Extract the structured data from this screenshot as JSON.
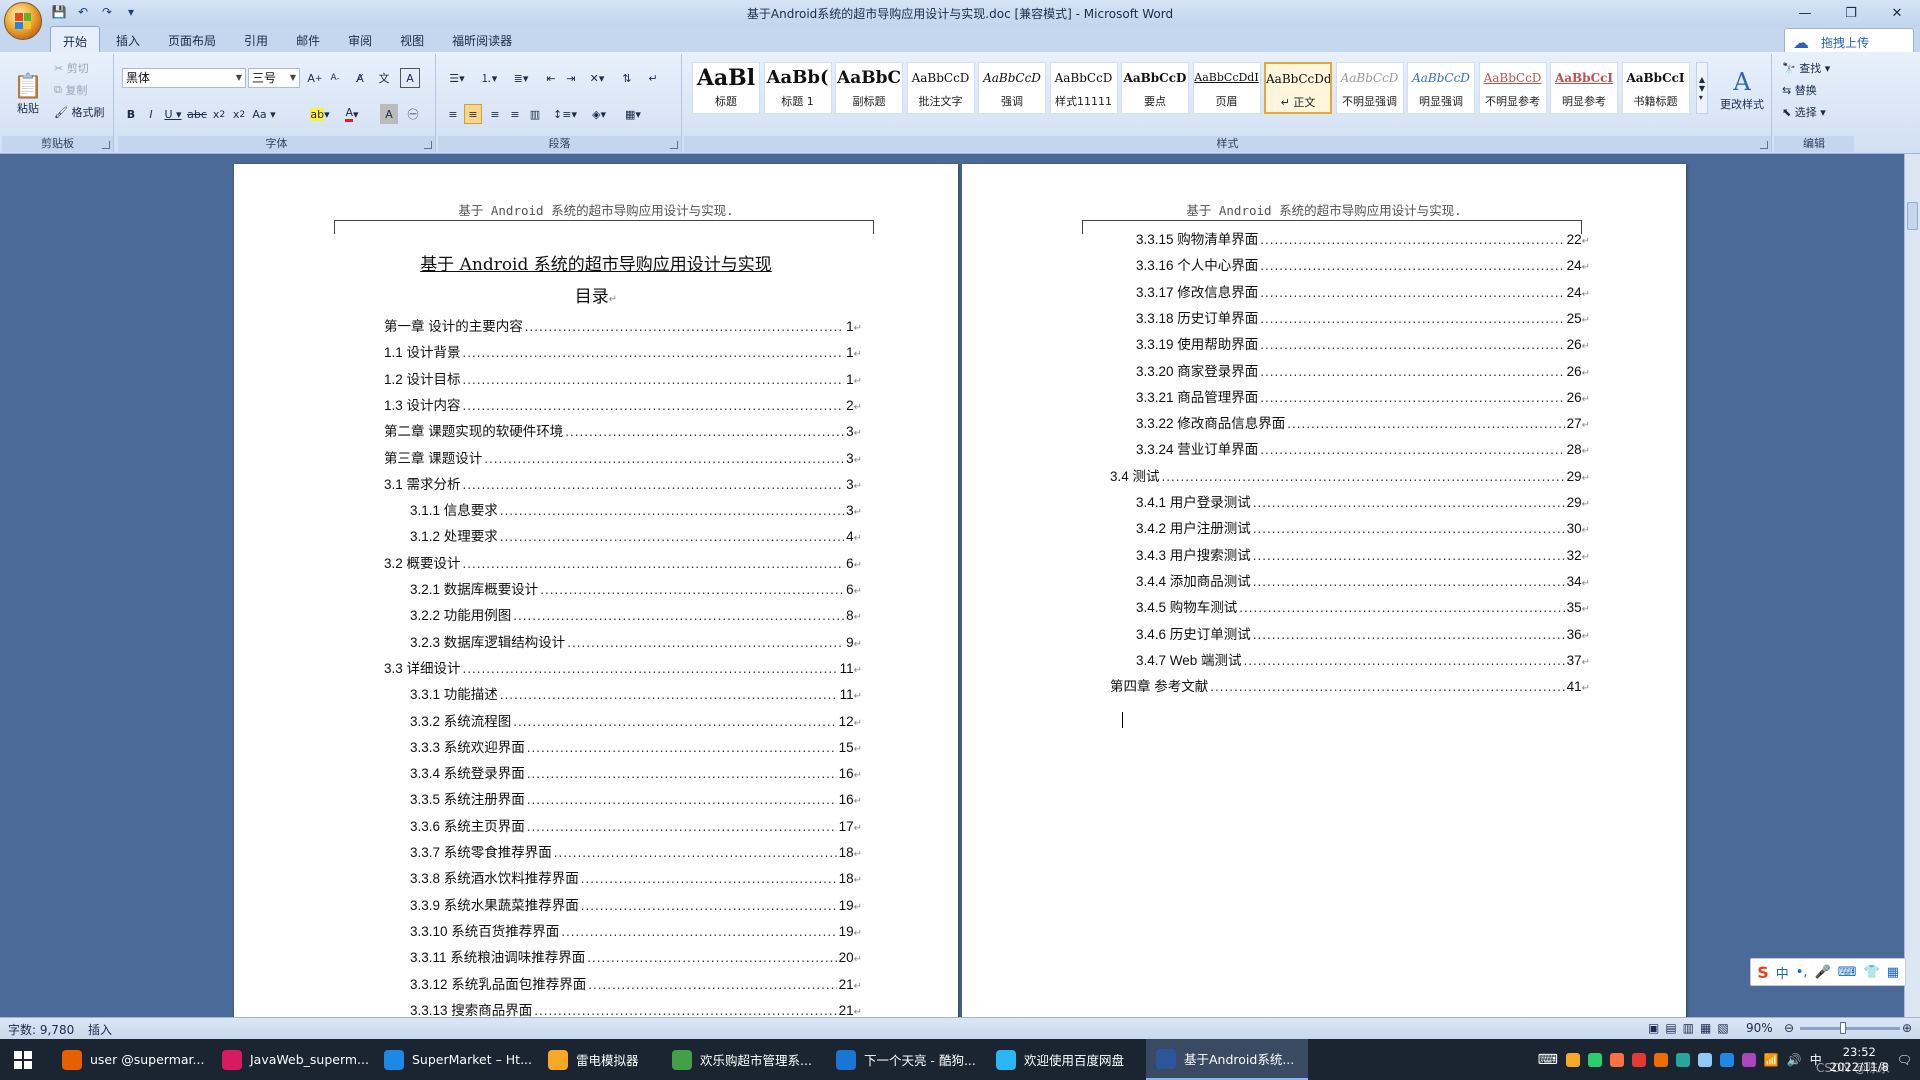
{
  "window": {
    "title": "基于Android系统的超市导购应用设计与实现.doc [兼容模式] - Microsoft Word"
  },
  "ribbon": {
    "tabs": [
      "开始",
      "插入",
      "页面布局",
      "引用",
      "邮件",
      "审阅",
      "视图",
      "福昕阅读器"
    ],
    "upload_label": "拖拽上传",
    "clipboard": {
      "paste": "粘贴",
      "cut": "剪切",
      "copy": "复制",
      "format_painter": "格式刷",
      "group_label": "剪贴板"
    },
    "font": {
      "font_name": "黑体",
      "font_size": "三号",
      "group_label": "字体"
    },
    "paragraph": {
      "group_label": "段落"
    },
    "styles": {
      "group_label": "样式",
      "change_styles": "更改样式",
      "items": [
        {
          "sample": "AaBl",
          "name": "标题"
        },
        {
          "sample": "AaBb(",
          "name": "标题 1"
        },
        {
          "sample": "AaBbC",
          "name": "副标题"
        },
        {
          "sample": "AaBbCcD",
          "name": "批注文字"
        },
        {
          "sample": "AaBbCcD",
          "name": "强调"
        },
        {
          "sample": "AaBbCcD",
          "name": "样式11111"
        },
        {
          "sample": "AaBbCcD",
          "name": "要点"
        },
        {
          "sample": "AaBbCcDdI",
          "name": "页眉"
        },
        {
          "sample": "AaBbCcDd",
          "name": "↵ 正文"
        },
        {
          "sample": "AaBbCcD",
          "name": "不明显强调"
        },
        {
          "sample": "AaBbCcD",
          "name": "明显强调"
        },
        {
          "sample": "AaBbCcD",
          "name": "不明显参考"
        },
        {
          "sample": "AaBbCcI",
          "name": "明显参考"
        },
        {
          "sample": "AaBbCcI",
          "name": "书籍标题"
        }
      ]
    },
    "editing": {
      "find": "查找",
      "replace": "替换",
      "select": "选择",
      "group_label": "编辑"
    }
  },
  "document": {
    "header": "基于 Android 系统的超市导购应用设计与实现.",
    "title": "基于 Android 系统的超市导购应用设计与实现",
    "toc_heading": "目录",
    "page1_toc": [
      {
        "text": "第一章  设计的主要内容",
        "page": "1",
        "indent": 0
      },
      {
        "text": "1.1  设计背景",
        "page": "1",
        "indent": 0
      },
      {
        "text": "1.2  设计目标",
        "page": "1",
        "indent": 0
      },
      {
        "text": "1.3  设计内容",
        "page": "2",
        "indent": 0
      },
      {
        "text": "第二章  课题实现的软硬件环境",
        "page": "3",
        "indent": 0
      },
      {
        "text": "第三章  课题设计",
        "page": "3",
        "indent": 0
      },
      {
        "text": "3.1 需求分析",
        "page": "3",
        "indent": 0
      },
      {
        "text": "3.1.1 信息要求",
        "page": "3",
        "indent": 1
      },
      {
        "text": "3.1.2 处理要求",
        "page": "4",
        "indent": 1
      },
      {
        "text": "3.2 概要设计",
        "page": "6",
        "indent": 0
      },
      {
        "text": "3.2.1 数据库概要设计",
        "page": "6",
        "indent": 1
      },
      {
        "text": "3.2.2 功能用例图",
        "page": "8",
        "indent": 1
      },
      {
        "text": "3.2.3 数据库逻辑结构设计",
        "page": "9",
        "indent": 1
      },
      {
        "text": "3.3 详细设计",
        "page": "11",
        "indent": 0
      },
      {
        "text": "3.3.1 功能描述",
        "page": "11",
        "indent": 1
      },
      {
        "text": "3.3.2 系统流程图",
        "page": "12",
        "indent": 1
      },
      {
        "text": "3.3.3 系统欢迎界面",
        "page": "15",
        "indent": 1
      },
      {
        "text": "3.3.4 系统登录界面",
        "page": "16",
        "indent": 1
      },
      {
        "text": "3.3.5 系统注册界面",
        "page": "16",
        "indent": 1
      },
      {
        "text": "3.3.6 系统主页界面",
        "page": "17",
        "indent": 1
      },
      {
        "text": "3.3.7 系统零食推荐界面",
        "page": "18",
        "indent": 1
      },
      {
        "text": "3.3.8 系统酒水饮料推荐界面",
        "page": "18",
        "indent": 1
      },
      {
        "text": "3.3.9 系统水果蔬菜推荐界面",
        "page": "19",
        "indent": 1
      },
      {
        "text": "3.3.10 系统百货推荐界面",
        "page": "19",
        "indent": 1
      },
      {
        "text": "3.3.11 系统粮油调味推荐界面",
        "page": "20",
        "indent": 1
      },
      {
        "text": "3.3.12 系统乳品面包推荐界面",
        "page": "21",
        "indent": 1
      },
      {
        "text": "3.3.13 搜索商品界面",
        "page": "21",
        "indent": 1
      }
    ],
    "page2_toc": [
      {
        "text": "3.3.15 购物清单界面",
        "page": "22",
        "indent": 1
      },
      {
        "text": "3.3.16 个人中心界面",
        "page": "24",
        "indent": 1
      },
      {
        "text": "3.3.17 修改信息界面",
        "page": "24",
        "indent": 1
      },
      {
        "text": "3.3.18 历史订单界面",
        "page": "25",
        "indent": 1
      },
      {
        "text": "3.3.19 使用帮助界面",
        "page": "26",
        "indent": 1
      },
      {
        "text": "3.3.20 商家登录界面",
        "page": "26",
        "indent": 1
      },
      {
        "text": "3.3.21 商品管理界面",
        "page": "26",
        "indent": 1
      },
      {
        "text": "3.3.22 修改商品信息界面",
        "page": "27",
        "indent": 1
      },
      {
        "text": "3.3.24 营业订单界面",
        "page": "28",
        "indent": 1
      },
      {
        "text": "3.4 测试",
        "page": "29",
        "indent": 0
      },
      {
        "text": "3.4.1 用户登录测试",
        "page": "29",
        "indent": 1
      },
      {
        "text": "3.4.2 用户注册测试",
        "page": "30",
        "indent": 1
      },
      {
        "text": "3.4.3 用户搜索测试",
        "page": "32",
        "indent": 1
      },
      {
        "text": "3.4.4 添加商品测试",
        "page": "34",
        "indent": 1
      },
      {
        "text": "3.4.5 购物车测试",
        "page": "35",
        "indent": 1
      },
      {
        "text": "3.4.6 历史订单测试",
        "page": "36",
        "indent": 1
      },
      {
        "text": "3.4.7 Web 端测试",
        "page": "37",
        "indent": 1
      },
      {
        "text": "第四章  参考文献",
        "page": "41",
        "indent": 0
      }
    ]
  },
  "status": {
    "word_count": "字数: 9,780",
    "mode": "插入",
    "zoom": "90%"
  },
  "taskbar": {
    "items": [
      {
        "label": "user @supermar...",
        "icon": "firefox-icon",
        "color": "#e66000"
      },
      {
        "label": "JavaWeb_superm...",
        "icon": "intellij-icon",
        "color": "#d81b60"
      },
      {
        "label": "SuperMarket – Ht...",
        "icon": "hbuilder-icon",
        "color": "#1e88e5"
      },
      {
        "label": "雷电模拟器",
        "icon": "ldplayer-icon",
        "color": "#f9a825"
      },
      {
        "label": "欢乐购超市管理系...",
        "icon": "chrome-icon",
        "color": "#43a047"
      },
      {
        "label": "下一个天亮 - 酷狗...",
        "icon": "kugou-icon",
        "color": "#1976d2"
      },
      {
        "label": "欢迎使用百度网盘",
        "icon": "baidu-netdisk-icon",
        "color": "#29b6f6"
      },
      {
        "label": "基于Android系统...",
        "icon": "word-icon",
        "color": "#2b579a"
      }
    ],
    "ime_lang": "中",
    "clock_time": "23:52",
    "clock_date": "2022/11/8",
    "watermark": "CSDN @陈永"
  }
}
